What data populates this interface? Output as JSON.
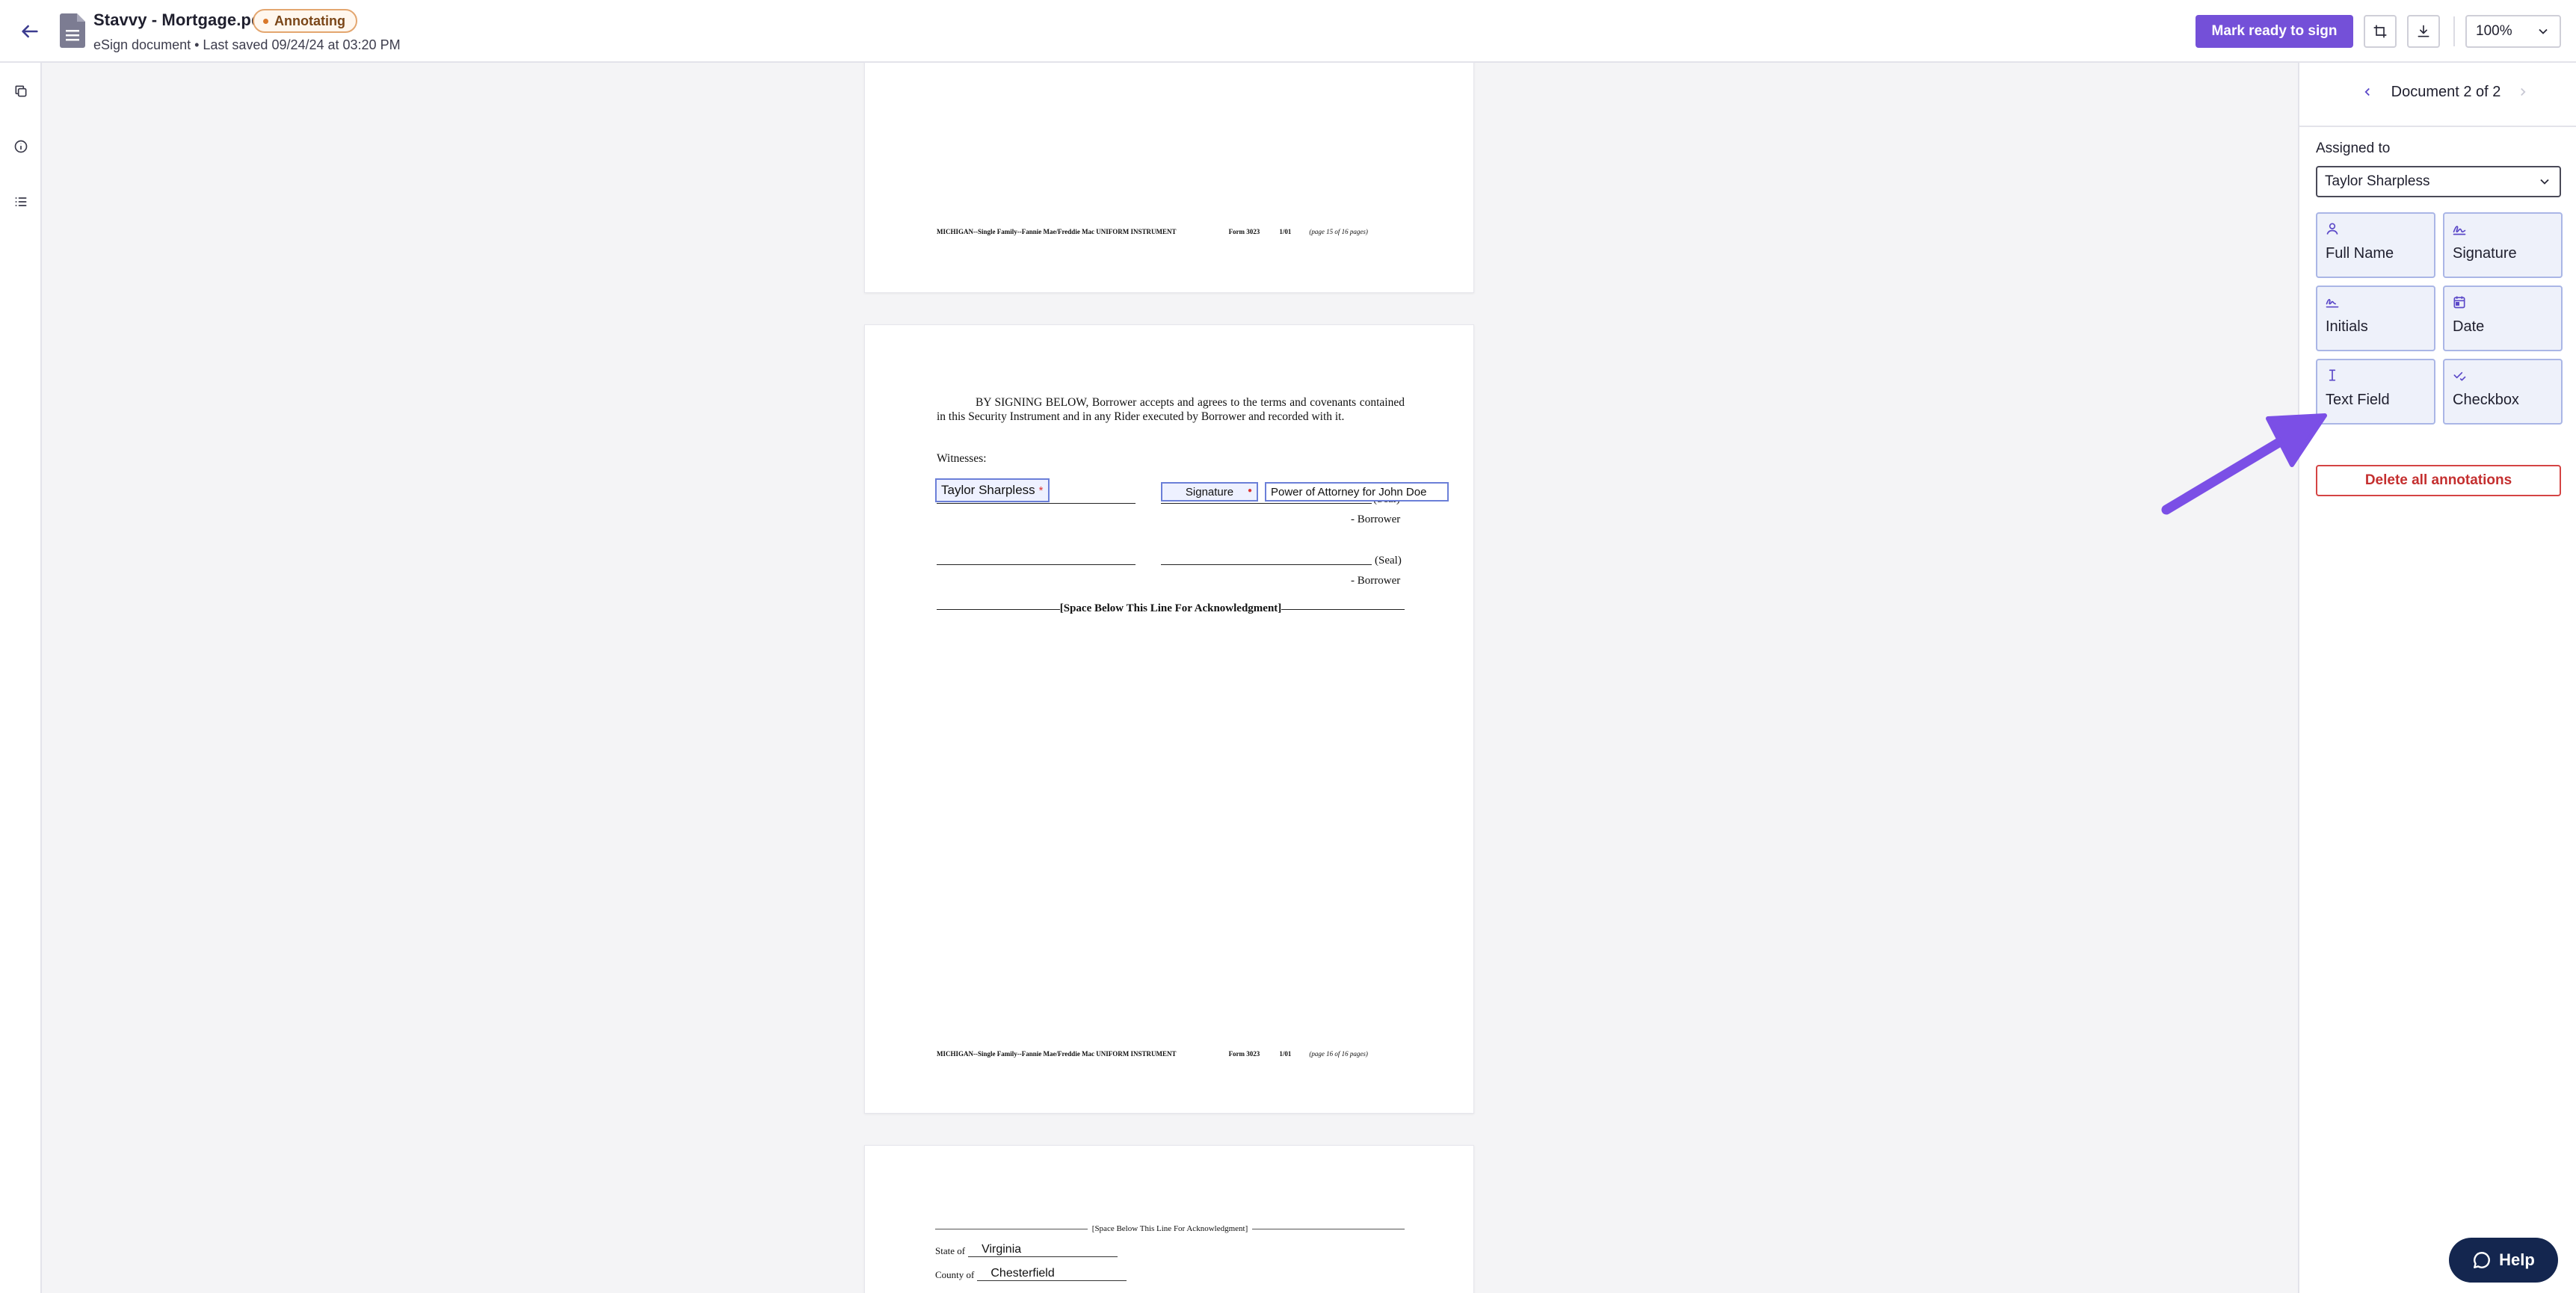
{
  "header": {
    "title": "Stavvy - Mortgage.pdf",
    "status": "Annotating",
    "subtitle": "eSign document • Last saved 09/24/24 at 03:20 PM",
    "mark_ready_label": "Mark ready to sign",
    "zoom": "100%"
  },
  "document": {
    "page_footer_a": "MICHIGAN--Single Family--Fannie Mae/Freddie Mac UNIFORM INSTRUMENT",
    "page_footer_form": "Form 3023",
    "page_footer_rev": "1/01",
    "page1_footer_pages": "(page 15 of 16 pages)",
    "page2_footer_pages": "(page 16 of 16 pages)",
    "signing_paragraph": "BY SIGNING BELOW, Borrower accepts and agrees to the terms and covenants contained in this Security Instrument and in any Rider executed by Borrower and recorded with it.",
    "witnesses_label": "Witnesses:",
    "seal_label": "(Seal)",
    "borrower_label": "- Borrower",
    "space_below_label": "[Space Below This Line For Acknowledgment]",
    "ack_label": "[Space Below This Line For Acknowledgment]",
    "state_label": "State of",
    "state_value": "Virginia",
    "county_label": "County of",
    "county_value": "Chesterfield",
    "annotations": {
      "full_name": "Taylor Sharpless",
      "signature": "Signature",
      "text_field": "Power of Attorney for John Doe"
    }
  },
  "panel": {
    "doc_nav_label": "Document 2 of 2",
    "assigned_label": "Assigned to",
    "assigned_value": "Taylor Sharpless",
    "tools": {
      "full_name": "Full Name",
      "signature": "Signature",
      "initials": "Initials",
      "date": "Date",
      "text_field": "Text Field",
      "checkbox": "Checkbox"
    },
    "delete_label": "Delete all annotations"
  },
  "help_label": "Help",
  "colors": {
    "accent": "#7450d8",
    "danger": "#c42f2f",
    "status": "#d9782a",
    "help": "#14264f"
  }
}
